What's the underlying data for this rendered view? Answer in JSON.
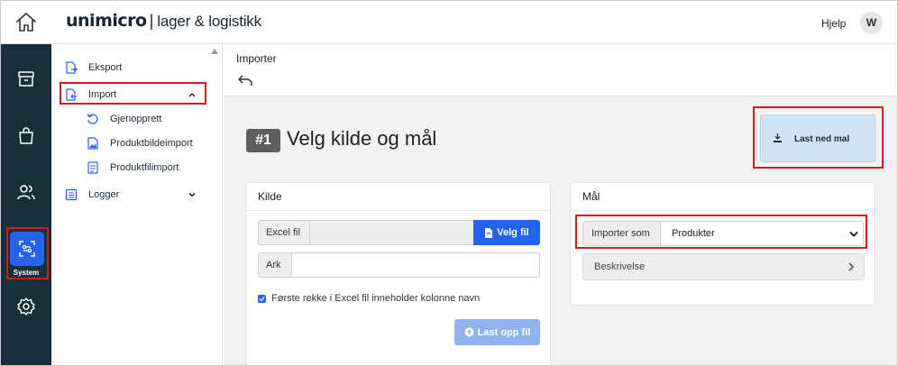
{
  "header": {
    "brand": "unimicro",
    "product": "lager & logistikk",
    "help_label": "Hjelp",
    "avatar_initial": "W"
  },
  "rail": {
    "items": [
      {
        "icon": "archive-icon"
      },
      {
        "icon": "shopping-bag-icon"
      },
      {
        "icon": "users-icon"
      },
      {
        "icon": "system-icon",
        "label": "System",
        "active": true
      },
      {
        "icon": "gear-icon"
      }
    ]
  },
  "sidebar": {
    "items": [
      {
        "label": "Eksport",
        "icon": "export-file-icon"
      },
      {
        "label": "Import",
        "icon": "import-file-icon",
        "expanded": true
      },
      {
        "label": "Gjenopprett",
        "icon": "restore-icon"
      },
      {
        "label": "Produktbildeimport",
        "icon": "image-import-icon"
      },
      {
        "label": "Produktfilimport",
        "icon": "file-import-icon"
      },
      {
        "label": "Logger",
        "icon": "log-icon",
        "expanded": false
      }
    ]
  },
  "main": {
    "breadcrumb": "Importer",
    "step_badge": "#1",
    "step_title": "Velg kilde og mål",
    "download_label": "Last ned mal",
    "kilde": {
      "title": "Kilde",
      "excel_label": "Excel fil",
      "excel_value": "",
      "choose_file_label": "Velg fil",
      "sheet_label": "Ark",
      "sheet_value": "",
      "first_row_checkbox_label": "Første rekke i Excel fil inneholder kolonne navn",
      "first_row_checked": true,
      "upload_label": "Last opp fil"
    },
    "maal": {
      "title": "Mål",
      "import_as_label": "Importer som",
      "import_as_value": "Produkter",
      "description_label": "Beskrivelse"
    }
  },
  "colors": {
    "rail_bg": "#17313a",
    "accent": "#2563eb",
    "highlight": "#d21b1b",
    "download_bg": "#cfe5f3"
  }
}
